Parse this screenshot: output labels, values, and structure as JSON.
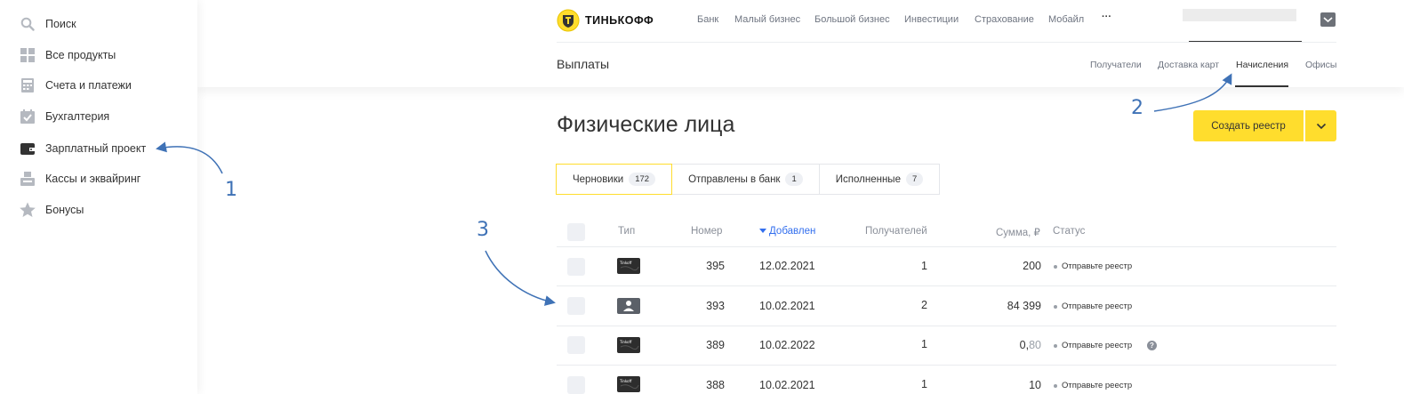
{
  "sidebar": {
    "items": [
      {
        "label": "Поиск",
        "icon": "search-icon"
      },
      {
        "label": "Все продукты",
        "icon": "grid-icon"
      },
      {
        "label": "Счета и платежи",
        "icon": "calculator-icon"
      },
      {
        "label": "Бухгалтерия",
        "icon": "calendar-check-icon"
      },
      {
        "label": "Зарплатный проект",
        "icon": "wallet-icon"
      },
      {
        "label": "Кассы и эквайринг",
        "icon": "cash-register-icon"
      },
      {
        "label": "Бонусы",
        "icon": "star-icon"
      }
    ]
  },
  "header": {
    "logo_text": "ТИНЬКОФФ",
    "nav": [
      "Банк",
      "Малый бизнес",
      "Большой бизнес",
      "Инвестиции",
      "Страхование",
      "Мобайл"
    ],
    "more": "···",
    "page_title": "Выплаты",
    "subnav": [
      "Получатели",
      "Доставка карт",
      "Начисления",
      "Офисы"
    ]
  },
  "main": {
    "title": "Физические лица",
    "create_button": "Создать реестр",
    "tabs": [
      {
        "label": "Черновики",
        "count": "172"
      },
      {
        "label": "Отправлены в банк",
        "count": "1"
      },
      {
        "label": "Исполненные",
        "count": "7"
      }
    ],
    "columns": {
      "type": "Тип",
      "number": "Номер",
      "added": "Добавлен",
      "recipients": "Получателей",
      "sum": "Сумма, ₽",
      "status": "Статус"
    },
    "rows": [
      {
        "type": "card",
        "number": "395",
        "date": "12.02.2021",
        "recipients": "1",
        "sum": "200",
        "sum_frac": "",
        "status": "Отправьте реестр"
      },
      {
        "type": "person",
        "number": "393",
        "date": "10.02.2021",
        "recipients": "2",
        "sum": "84 399",
        "sum_frac": "",
        "status": "Отправьте реестр"
      },
      {
        "type": "card",
        "number": "389",
        "date": "10.02.2022",
        "recipients": "1",
        "sum": "0,",
        "sum_frac": "80",
        "status": "Отправьте реестр"
      },
      {
        "type": "card",
        "number": "388",
        "date": "10.02.2021",
        "recipients": "1",
        "sum": "10",
        "sum_frac": "",
        "status": "Отправьте реестр"
      }
    ]
  },
  "annotations": {
    "a1": "1",
    "a2": "2",
    "a3": "3"
  },
  "colors": {
    "accent": "#ffdd2d",
    "link": "#336fee",
    "annotation": "#3f72b6"
  }
}
